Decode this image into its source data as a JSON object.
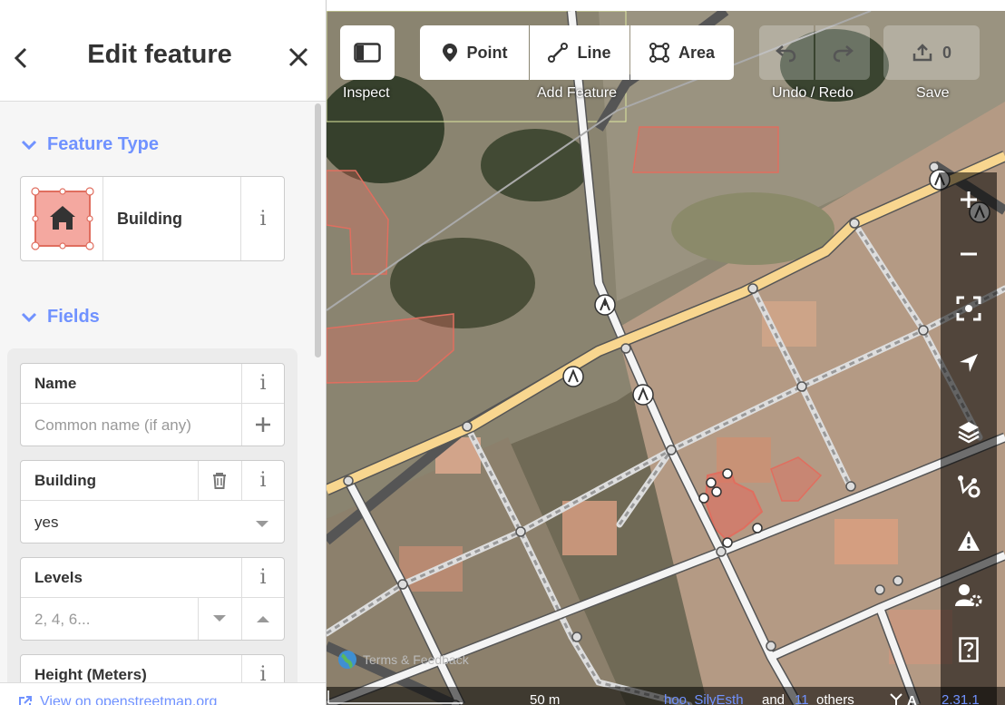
{
  "sidebar": {
    "title": "Edit feature",
    "feature_type_section": "Feature Type",
    "preset_name": "Building",
    "fields_section": "Fields",
    "fields": {
      "name": {
        "label": "Name",
        "placeholder": "Common name (if any)"
      },
      "building": {
        "label": "Building",
        "value": "yes"
      },
      "levels": {
        "label": "Levels",
        "placeholder": "2, 4, 6..."
      },
      "height": {
        "label": "Height (Meters)"
      }
    },
    "info_glyph": "i",
    "footer_link": "View on openstreetmap.org"
  },
  "toolbar": {
    "inspect_label": "Inspect",
    "point_label": "Point",
    "line_label": "Line",
    "area_label": "Area",
    "add_feature_label": "Add Feature",
    "undo_redo_label": "Undo / Redo",
    "save_label": "Save",
    "save_count": "0"
  },
  "map": {
    "attribution": "Terms & Feedback",
    "scale": "50 m",
    "contributors": "hoo, SilyEsth",
    "contributors_and": "and",
    "others_count": "11",
    "others_label": "others",
    "version": "2.31.1"
  },
  "colors": {
    "accent": "#7092ff",
    "building_fill": "#e06e5f",
    "road_primary": "#f8d68f"
  },
  "icons": [
    "chevron-left-icon",
    "close-icon",
    "chevron-down-icon",
    "house-icon",
    "info-icon",
    "plus-icon",
    "trash-icon",
    "dropdown-icon",
    "stepper-up-icon",
    "external-link-icon",
    "sidebar-toggle-icon",
    "point-icon",
    "line-icon",
    "area-icon",
    "undo-icon",
    "redo-icon",
    "upload-icon",
    "zoom-in-icon",
    "zoom-out-icon",
    "zoom-to-selection-icon",
    "locate-icon",
    "layers-icon",
    "map-data-icon",
    "issues-icon",
    "preferences-icon",
    "help-icon",
    "crossing-icon"
  ]
}
